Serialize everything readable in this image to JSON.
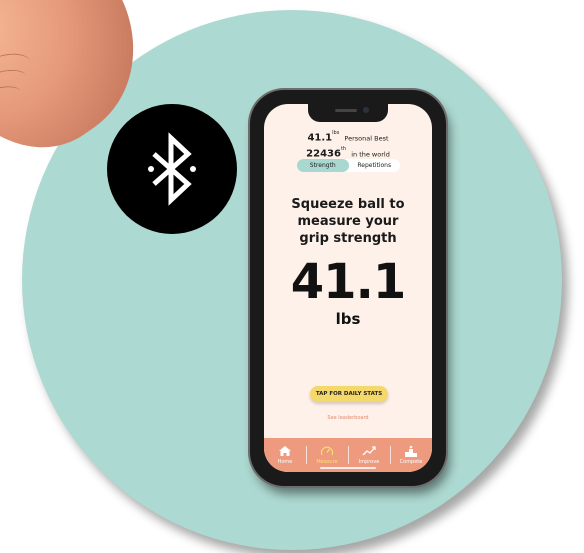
{
  "personal_best": {
    "value": "41.1",
    "unit_sup": "lbs",
    "label": "Personal Best",
    "rank": "22436",
    "rank_sup": "th",
    "rank_label": "in the world"
  },
  "tabs": [
    {
      "label": "Strength",
      "active": true
    },
    {
      "label": "Repetitions",
      "active": false
    }
  ],
  "prompt": {
    "line1": "Squeeze ball to",
    "line2": "measure your",
    "line3": "grip strength"
  },
  "reading": {
    "value": "41.1",
    "unit": "lbs"
  },
  "stats_button": "TAP FOR DAILY STATS",
  "leaderboard_link": "See leaderboard",
  "nav": [
    {
      "label": "Home",
      "icon": "home-icon",
      "active": false
    },
    {
      "label": "Measure",
      "icon": "gauge-icon",
      "active": true
    },
    {
      "label": "Improve",
      "icon": "trend-icon",
      "active": false
    },
    {
      "label": "Compete",
      "icon": "podium-icon",
      "active": false
    }
  ],
  "colors": {
    "circle": "#acd9d1",
    "screen": "#fdf1e9",
    "accent_tab": "#a8d8cf",
    "nav": "#ee9a7e",
    "button": "#f5d86a",
    "active_nav": "#f6e46a"
  }
}
